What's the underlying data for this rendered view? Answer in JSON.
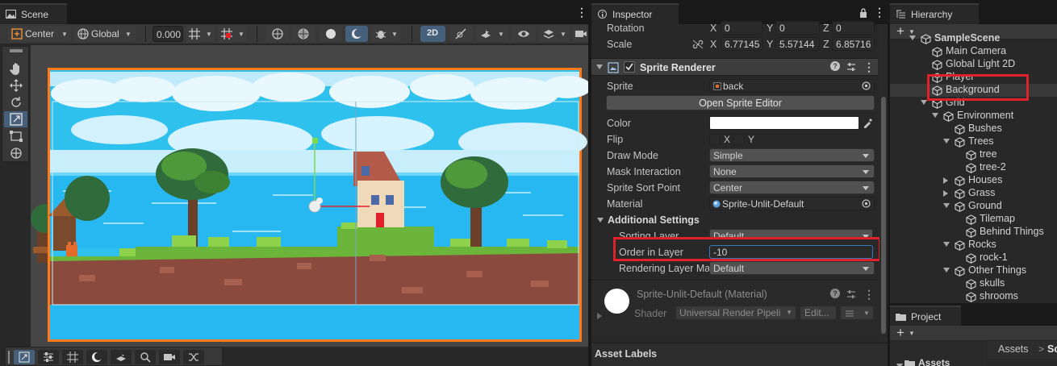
{
  "scene": {
    "tab_label": "Scene",
    "pivot_label": "Center",
    "space_label": "Global",
    "snap_value": "0.000",
    "mode_2d_label": "2D",
    "colors": {
      "border": "#ff7a1a",
      "sky": "#2fc1ee",
      "water": "#27b8f2"
    }
  },
  "inspector": {
    "tab_label": "Inspector",
    "rotation": {
      "label": "Rotation",
      "x": "0",
      "y": "0",
      "z": "0"
    },
    "scale": {
      "label": "Scale",
      "x": "6.77145",
      "y": "5.57144",
      "z": "6.85716"
    },
    "component_title": "Sprite Renderer",
    "sprite": {
      "label": "Sprite",
      "value": "back"
    },
    "open_sprite_editor_label": "Open Sprite Editor",
    "color": {
      "label": "Color",
      "value": "#ffffff"
    },
    "flip": {
      "label": "Flip",
      "x": "X",
      "y": "Y"
    },
    "draw_mode": {
      "label": "Draw Mode",
      "value": "Simple"
    },
    "mask_interaction": {
      "label": "Mask Interaction",
      "value": "None"
    },
    "sprite_sort_point": {
      "label": "Sprite Sort Point",
      "value": "Center"
    },
    "material": {
      "label": "Material",
      "value": "Sprite-Unlit-Default"
    },
    "additional_settings_label": "Additional Settings",
    "sorting_layer": {
      "label": "Sorting Layer",
      "value": "Default"
    },
    "order_in_layer": {
      "label": "Order in Layer",
      "value": "-10"
    },
    "rendering_layer_mask": {
      "label": "Rendering Layer Ma",
      "value": "Default"
    },
    "material_block": {
      "title": "Sprite-Unlit-Default (Material)",
      "shader_label": "Shader",
      "shader_value": "Universal Render Pipeli",
      "edit_label": "Edit..."
    },
    "asset_labels": "Asset Labels"
  },
  "hierarchy": {
    "tab_label": "Hierarchy",
    "items": [
      {
        "label": "SampleScene",
        "depth": 0,
        "arrow": "down",
        "kind": "scene"
      },
      {
        "label": "Main Camera",
        "depth": 1,
        "arrow": "none"
      },
      {
        "label": "Global Light 2D",
        "depth": 1,
        "arrow": "none"
      },
      {
        "label": "Player",
        "depth": 1,
        "arrow": "none"
      },
      {
        "label": "Background",
        "depth": 1,
        "arrow": "none",
        "selected": true
      },
      {
        "label": "Grid",
        "depth": 1,
        "arrow": "down"
      },
      {
        "label": "Environment",
        "depth": 2,
        "arrow": "down"
      },
      {
        "label": "Bushes",
        "depth": 3,
        "arrow": "none"
      },
      {
        "label": "Trees",
        "depth": 3,
        "arrow": "down"
      },
      {
        "label": "tree",
        "depth": 4,
        "arrow": "none"
      },
      {
        "label": "tree-2",
        "depth": 4,
        "arrow": "none"
      },
      {
        "label": "Houses",
        "depth": 3,
        "arrow": "right"
      },
      {
        "label": "Grass",
        "depth": 3,
        "arrow": "right"
      },
      {
        "label": "Ground",
        "depth": 3,
        "arrow": "down"
      },
      {
        "label": "Tilemap",
        "depth": 4,
        "arrow": "none"
      },
      {
        "label": "Behind Things",
        "depth": 4,
        "arrow": "none"
      },
      {
        "label": "Rocks",
        "depth": 3,
        "arrow": "down"
      },
      {
        "label": "rock-1",
        "depth": 4,
        "arrow": "none"
      },
      {
        "label": "Other Things",
        "depth": 3,
        "arrow": "down"
      },
      {
        "label": "skulls",
        "depth": 4,
        "arrow": "none"
      },
      {
        "label": "shrooms",
        "depth": 4,
        "arrow": "none"
      }
    ]
  },
  "project": {
    "tab_label": "Project",
    "breadcrumb": "Assets",
    "breadcrumb_next": "Scr",
    "folder": "Assets"
  },
  "icons": [
    "hand-icon",
    "move-icon",
    "rotate-icon",
    "scale-icon",
    "rect-icon",
    "transform-icon",
    "gameobject-cube-icon",
    "lock-icon",
    "kebab-menu-icon",
    "help-icon",
    "settings-icon",
    "add-icon",
    "search-icon",
    "link-icon",
    "eyedropper-icon",
    "target-icon"
  ]
}
